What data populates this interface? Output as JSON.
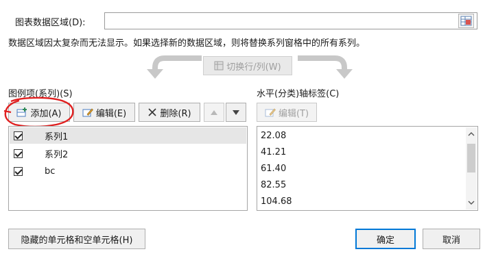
{
  "range": {
    "label": "图表数据区域(D):",
    "value": ""
  },
  "message": "数据区域因太复杂而无法显示。如果选择新的数据区域，则将替换系列窗格中的所有系列。",
  "switch_row_col": "切换行/列(W)",
  "legend": {
    "title": "图例项(系列)(S)",
    "add": "添加(A)",
    "edit": "编辑(E)",
    "delete": "删除(R)",
    "series": [
      {
        "name": "系列1",
        "checked": true,
        "selected": true
      },
      {
        "name": "系列2",
        "checked": true,
        "selected": false
      },
      {
        "name": "bc",
        "checked": true,
        "selected": false
      }
    ]
  },
  "axis": {
    "title": "水平(分类)轴标签(C)",
    "edit": "编辑(T)",
    "values": [
      "22.08",
      "41.21",
      "61.40",
      "82.55",
      "104.68"
    ]
  },
  "hidden_cells": "隐藏的单元格和空单元格(H)",
  "ok": "确定",
  "cancel": "取消",
  "colors": {
    "accent": "#0078d7",
    "annotation": "#e02020"
  }
}
